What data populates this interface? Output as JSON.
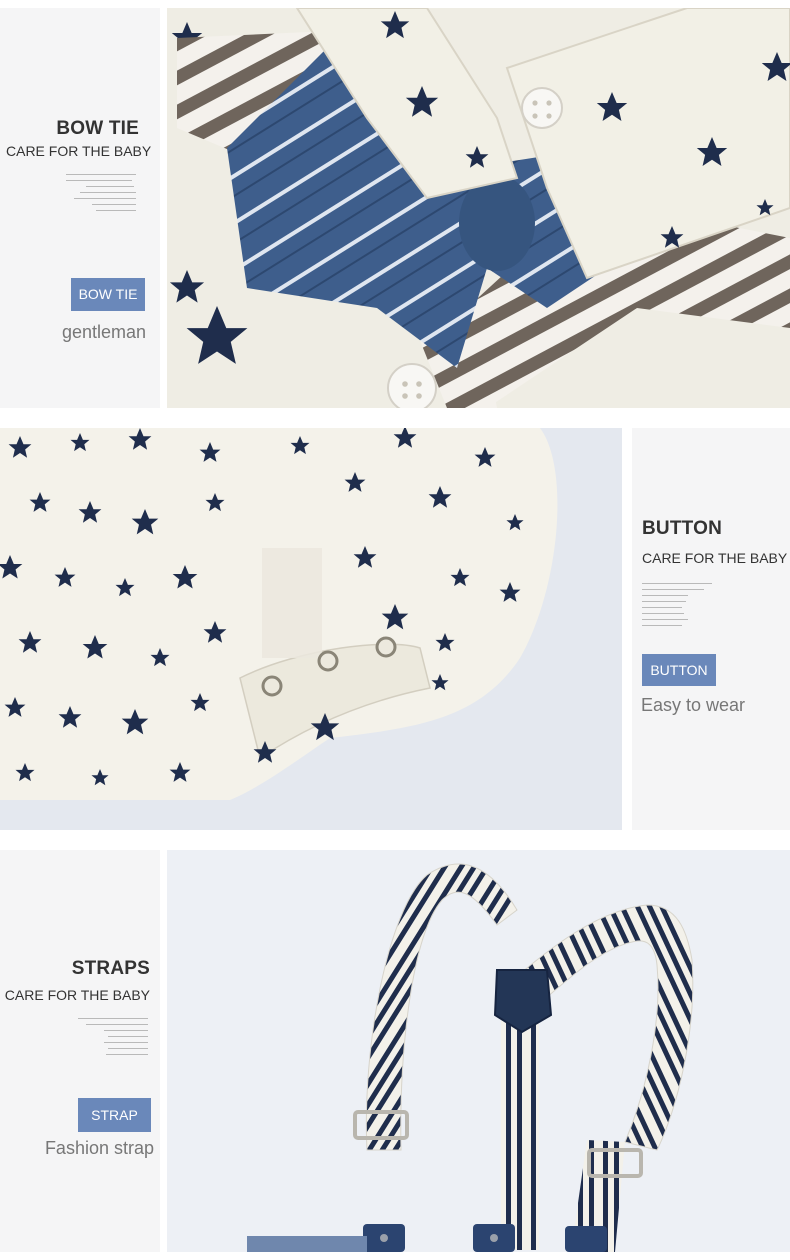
{
  "sections": [
    {
      "title": "BOW TIE",
      "subtitle": "CARE FOR THE BABY",
      "badge": "BOW TIE",
      "tagline": "gentleman",
      "photo_icon": "bow-tie-collar-photo"
    },
    {
      "title": "BUTTON",
      "subtitle": "CARE FOR THE BABY",
      "badge": "BUTTON",
      "tagline": "Easy to wear",
      "photo_icon": "star-bodysuit-snap-buttons-photo"
    },
    {
      "title": "STRAPS",
      "subtitle": "CARE FOR THE BABY",
      "badge": "STRAP",
      "tagline": "Fashion strap",
      "photo_icon": "striped-suspenders-photo"
    }
  ],
  "colors": {
    "panel_bg": "#f5f5f6",
    "badge_bg": "#6a88ba",
    "title_text": "#333333",
    "tagline_text": "#777777",
    "star_navy": "#1f2d4c",
    "fabric_cream": "#f2f0e6",
    "denim_blue": "#3f5f8f"
  }
}
